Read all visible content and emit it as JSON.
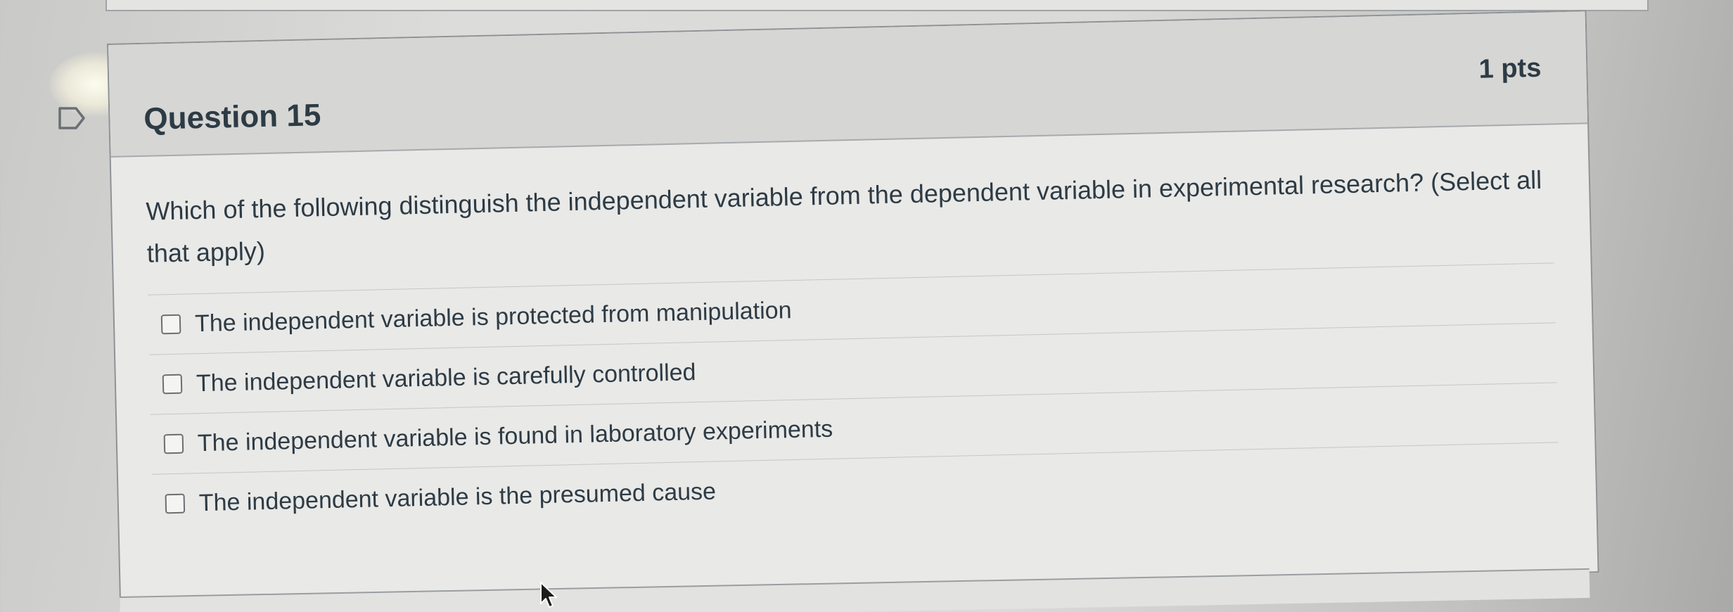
{
  "question": {
    "title": "Question 15",
    "points": "1 pts",
    "text": "Which of the following distinguish the independent variable from the dependent variable in experimental research? (Select all that apply)",
    "answers": [
      {
        "label": "The independent variable is protected from manipulation",
        "checked": false
      },
      {
        "label": "The independent variable is carefully controlled",
        "checked": false
      },
      {
        "label": "The independent variable is found in laboratory experiments",
        "checked": false
      },
      {
        "label": "The independent variable is the presumed cause",
        "checked": false
      }
    ]
  },
  "icons": {
    "flag": "flag-icon",
    "cursor": "mouse-cursor-icon"
  }
}
